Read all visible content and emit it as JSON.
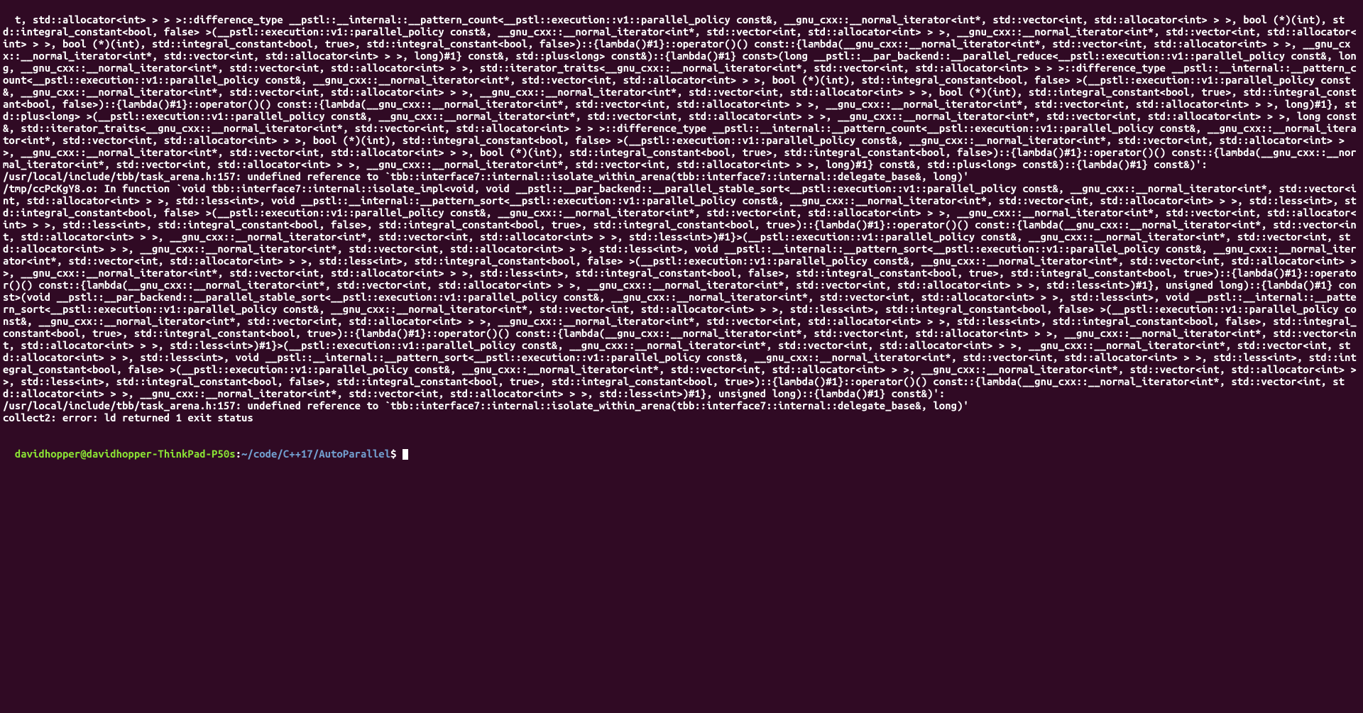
{
  "terminal": {
    "error_output": "t, std::allocator<int> > > >::difference_type __pstl::__internal::__pattern_count<__pstl::execution::v1::parallel_policy const&, __gnu_cxx::__normal_iterator<int*, std::vector<int, std::allocator<int> > >, bool (*)(int), std::integral_constant<bool, false> >(__pstl::execution::v1::parallel_policy const&, __gnu_cxx::__normal_iterator<int*, std::vector<int, std::allocator<int> > >, __gnu_cxx::__normal_iterator<int*, std::vector<int, std::allocator<int> > >, bool (*)(int), std::integral_constant<bool, true>, std::integral_constant<bool, false>)::{lambda()#1}::operator()() const::{lambda(__gnu_cxx::__normal_iterator<int*, std::vector<int, std::allocator<int> > >, __gnu_cxx::__normal_iterator<int*, std::vector<int, std::allocator<int> > >, long)#1} const&, std::plus<long> const&)::{lambda()#1} const>(long __pstl::__par_backend::__parallel_reduce<__pstl::execution::v1::parallel_policy const&, long, __gnu_cxx::__normal_iterator<int*, std::vector<int, std::allocator<int> > >, std::iterator_traits<__gnu_cxx::__normal_iterator<int*, std::vector<int, std::allocator<int> > > >::difference_type __pstl::__internal::__pattern_count<__pstl::execution::v1::parallel_policy const&, __gnu_cxx::__normal_iterator<int*, std::vector<int, std::allocator<int> > >, bool (*)(int), std::integral_constant<bool, false> >(__pstl::execution::v1::parallel_policy const&, __gnu_cxx::__normal_iterator<int*, std::vector<int, std::allocator<int> > >, __gnu_cxx::__normal_iterator<int*, std::vector<int, std::allocator<int> > >, bool (*)(int), std::integral_constant<bool, true>, std::integral_constant<bool, false>)::{lambda()#1}::operator()() const::{lambda(__gnu_cxx::__normal_iterator<int*, std::vector<int, std::allocator<int> > >, __gnu_cxx::__normal_iterator<int*, std::vector<int, std::allocator<int> > >, long)#1}, std::plus<long> >(__pstl::execution::v1::parallel_policy const&, __gnu_cxx::__normal_iterator<int*, std::vector<int, std::allocator<int> > >, __gnu_cxx::__normal_iterator<int*, std::vector<int, std::allocator<int> > >, long const&, std::iterator_traits<__gnu_cxx::__normal_iterator<int*, std::vector<int, std::allocator<int> > > >::difference_type __pstl::__internal::__pattern_count<__pstl::execution::v1::parallel_policy const&, __gnu_cxx::__normal_iterator<int*, std::vector<int, std::allocator<int> > >, bool (*)(int), std::integral_constant<bool, false> >(__pstl::execution::v1::parallel_policy const&, __gnu_cxx::__normal_iterator<int*, std::vector<int, std::allocator<int> > >, __gnu_cxx::__normal_iterator<int*, std::vector<int, std::allocator<int> > >, bool (*)(int), std::integral_constant<bool, true>, std::integral_constant<bool, false>)::{lambda()#1}::operator()() const::{lambda(__gnu_cxx::__normal_iterator<int*, std::vector<int, std::allocator<int> > >, __gnu_cxx::__normal_iterator<int*, std::vector<int, std::allocator<int> > >, long)#1} const&, std::plus<long> const&)::{lambda()#1} const&)':\n/usr/local/include/tbb/task_arena.h:157: undefined reference to `tbb::interface7::internal::isolate_within_arena(tbb::interface7::internal::delegate_base&, long)'\n/tmp/ccPcKgY8.o: In function `void tbb::interface7::internal::isolate_impl<void, void __pstl::__par_backend::__parallel_stable_sort<__pstl::execution::v1::parallel_policy const&, __gnu_cxx::__normal_iterator<int*, std::vector<int, std::allocator<int> > >, std::less<int>, void __pstl::__internal::__pattern_sort<__pstl::execution::v1::parallel_policy const&, __gnu_cxx::__normal_iterator<int*, std::vector<int, std::allocator<int> > >, std::less<int>, std::integral_constant<bool, false> >(__pstl::execution::v1::parallel_policy const&, __gnu_cxx::__normal_iterator<int*, std::vector<int, std::allocator<int> > >, __gnu_cxx::__normal_iterator<int*, std::vector<int, std::allocator<int> > >, std::less<int>, std::integral_constant<bool, false>, std::integral_constant<bool, true>, std::integral_constant<bool, true>)::{lambda()#1}::operator()() const::{lambda(__gnu_cxx::__normal_iterator<int*, std::vector<int, std::allocator<int> > >, __gnu_cxx::__normal_iterator<int*, std::vector<int, std::allocator<int> > >, std::less<int>)#1}>(__pstl::execution::v1::parallel_policy const&, __gnu_cxx::__normal_iterator<int*, std::vector<int, std::allocator<int> > >, __gnu_cxx::__normal_iterator<int*, std::vector<int, std::allocator<int> > >, std::less<int>, void __pstl::__internal::__pattern_sort<__pstl::execution::v1::parallel_policy const&, __gnu_cxx::__normal_iterator<int*, std::vector<int, std::allocator<int> > >, std::less<int>, std::integral_constant<bool, false> >(__pstl::execution::v1::parallel_policy const&, __gnu_cxx::__normal_iterator<int*, std::vector<int, std::allocator<int> > >, __gnu_cxx::__normal_iterator<int*, std::vector<int, std::allocator<int> > >, std::less<int>, std::integral_constant<bool, false>, std::integral_constant<bool, true>, std::integral_constant<bool, true>)::{lambda()#1}::operator()() const::{lambda(__gnu_cxx::__normal_iterator<int*, std::vector<int, std::allocator<int> > >, __gnu_cxx::__normal_iterator<int*, std::vector<int, std::allocator<int> > >, std::less<int>)#1}, unsigned long)::{lambda()#1} const>(void __pstl::__par_backend::__parallel_stable_sort<__pstl::execution::v1::parallel_policy const&, __gnu_cxx::__normal_iterator<int*, std::vector<int, std::allocator<int> > >, std::less<int>, void __pstl::__internal::__pattern_sort<__pstl::execution::v1::parallel_policy const&, __gnu_cxx::__normal_iterator<int*, std::vector<int, std::allocator<int> > >, std::less<int>, std::integral_constant<bool, false> >(__pstl::execution::v1::parallel_policy const&, __gnu_cxx::__normal_iterator<int*, std::vector<int, std::allocator<int> > >, __gnu_cxx::__normal_iterator<int*, std::vector<int, std::allocator<int> > >, std::less<int>, std::integral_constant<bool, false>, std::integral_constant<bool, true>, std::integral_constant<bool, true>)::{lambda()#1}::operator()() const::{lambda(__gnu_cxx::__normal_iterator<int*, std::vector<int, std::allocator<int> > >, __gnu_cxx::__normal_iterator<int*, std::vector<int, std::allocator<int> > >, std::less<int>)#1}>(__pstl::execution::v1::parallel_policy const&, __gnu_cxx::__normal_iterator<int*, std::vector<int, std::allocator<int> > >, __gnu_cxx::__normal_iterator<int*, std::vector<int, std::allocator<int> > >, std::less<int>, void __pstl::__internal::__pattern_sort<__pstl::execution::v1::parallel_policy const&, __gnu_cxx::__normal_iterator<int*, std::vector<int, std::allocator<int> > >, std::less<int>, std::integral_constant<bool, false> >(__pstl::execution::v1::parallel_policy const&, __gnu_cxx::__normal_iterator<int*, std::vector<int, std::allocator<int> > >, __gnu_cxx::__normal_iterator<int*, std::vector<int, std::allocator<int> > >, std::less<int>, std::integral_constant<bool, false>, std::integral_constant<bool, true>, std::integral_constant<bool, true>)::{lambda()#1}::operator()() const::{lambda(__gnu_cxx::__normal_iterator<int*, std::vector<int, std::allocator<int> > >, __gnu_cxx::__normal_iterator<int*, std::vector<int, std::allocator<int> > >, std::less<int>)#1}, unsigned long)::{lambda()#1} const&)':\n/usr/local/include/tbb/task_arena.h:157: undefined reference to `tbb::interface7::internal::isolate_within_arena(tbb::interface7::internal::delegate_base&, long)'\ncollect2: error: ld returned 1 exit status",
    "prompt": {
      "user_host": "davidhopper@davidhopper-ThinkPad-P50s",
      "separator": ":",
      "path": "~/code/C++17/AutoParallel",
      "end": "$ "
    }
  }
}
